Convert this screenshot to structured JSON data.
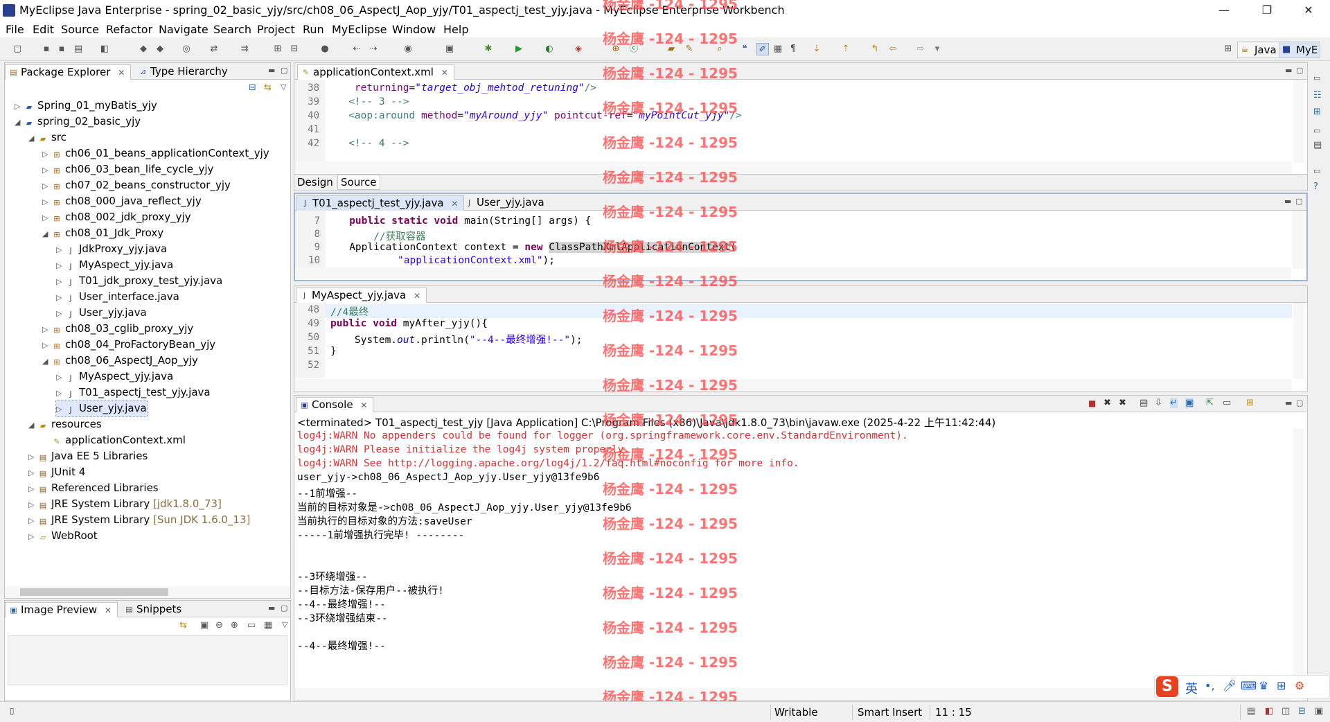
{
  "window": {
    "title": "MyEclipse Java Enterprise - spring_02_basic_yjy/src/ch08_06_AspectJ_Aop_yjy/T01_aspectj_test_yjy.java - MyEclipse Enterprise Workbench",
    "minimize": "—",
    "restore": "❐",
    "close": "✕"
  },
  "menu": [
    "File",
    "Edit",
    "Source",
    "Refactor",
    "Navigate",
    "Search",
    "Project",
    "Run",
    "MyEclipse",
    "Window",
    "Help"
  ],
  "perspectives": {
    "java": "Java",
    "myeclipse": "MyE"
  },
  "package_explorer": {
    "tabs": [
      "Package Explorer",
      "Type Hierarchy"
    ],
    "tree": [
      {
        "label": "Spring_01_myBatis_yjy",
        "indent": 0,
        "icon": "project-icon",
        "exp": "▷"
      },
      {
        "label": "spring_02_basic_yjy",
        "indent": 0,
        "icon": "project-icon",
        "exp": "◢"
      },
      {
        "label": "src",
        "indent": 1,
        "icon": "source-folder-icon",
        "exp": "◢"
      },
      {
        "label": "ch06_01_beans_applicationContext_yjy",
        "indent": 2,
        "icon": "package-icon",
        "exp": "▷"
      },
      {
        "label": "ch06_03_bean_life_cycle_yjy",
        "indent": 2,
        "icon": "package-icon",
        "exp": "▷"
      },
      {
        "label": "ch07_02_beans_constructor_yjy",
        "indent": 2,
        "icon": "package-icon",
        "exp": "▷"
      },
      {
        "label": "ch08_000_java_reflect_yjy",
        "indent": 2,
        "icon": "package-icon",
        "exp": "▷"
      },
      {
        "label": "ch08_002_jdk_proxy_yjy",
        "indent": 2,
        "icon": "package-icon",
        "exp": "▷"
      },
      {
        "label": "ch08_01_Jdk_Proxy",
        "indent": 2,
        "icon": "package-icon",
        "exp": "◢"
      },
      {
        "label": "JdkProxy_yjy.java",
        "indent": 3,
        "icon": "java-file-icon",
        "exp": "▷"
      },
      {
        "label": "MyAspect_yjy.java",
        "indent": 3,
        "icon": "java-file-icon",
        "exp": "▷"
      },
      {
        "label": "T01_jdk_proxy_test_yjy.java",
        "indent": 3,
        "icon": "java-file-icon",
        "exp": "▷"
      },
      {
        "label": "User_interface.java",
        "indent": 3,
        "icon": "java-file-icon",
        "exp": "▷"
      },
      {
        "label": "User_yjy.java",
        "indent": 3,
        "icon": "java-file-icon",
        "exp": "▷"
      },
      {
        "label": "ch08_03_cglib_proxy_yjy",
        "indent": 2,
        "icon": "package-icon",
        "exp": "▷"
      },
      {
        "label": "ch08_04_ProFactoryBean_yjy",
        "indent": 2,
        "icon": "package-icon",
        "exp": "▷"
      },
      {
        "label": "ch08_06_AspectJ_Aop_yjy",
        "indent": 2,
        "icon": "package-icon",
        "exp": "◢"
      },
      {
        "label": "MyAspect_yjy.java",
        "indent": 3,
        "icon": "java-file-icon",
        "exp": "▷"
      },
      {
        "label": "T01_aspectj_test_yjy.java",
        "indent": 3,
        "icon": "java-file-icon",
        "exp": "▷"
      },
      {
        "label": "User_yjy.java",
        "indent": 3,
        "icon": "java-file-icon",
        "exp": "▷",
        "selected": true
      },
      {
        "label": "resources",
        "indent": 1,
        "icon": "source-folder-icon",
        "exp": "◢"
      },
      {
        "label": "applicationContext.xml",
        "indent": 2,
        "icon": "xml-file-icon",
        "exp": ""
      },
      {
        "label": "Java EE 5 Libraries",
        "indent": 1,
        "icon": "library-icon",
        "exp": "▷"
      },
      {
        "label": "JUnit 4",
        "indent": 1,
        "icon": "library-icon",
        "exp": "▷"
      },
      {
        "label": "Referenced Libraries",
        "indent": 1,
        "icon": "library-icon",
        "exp": "▷"
      },
      {
        "label": "JRE System Library",
        "suffix": "[jdk1.8.0_73]",
        "indent": 1,
        "icon": "library-icon",
        "exp": "▷"
      },
      {
        "label": "JRE System Library",
        "suffix": "[Sun JDK 1.6.0_13]",
        "indent": 1,
        "icon": "library-icon",
        "exp": "▷"
      },
      {
        "label": "WebRoot",
        "indent": 1,
        "icon": "folder-icon",
        "exp": "▷"
      }
    ]
  },
  "image_preview": {
    "tabs": [
      "Image Preview",
      "Snippets"
    ]
  },
  "xml_editor": {
    "tab": "applicationContext.xml",
    "bottom_tabs": [
      "Design",
      "Source"
    ],
    "lines": [
      {
        "n": "38",
        "html": "    <span class=\"attr\">returning</span>=<span class=\"attrval\">\"target_obj_mehtod_retuning\"</span><span class=\"tag\">/&gt;</span>"
      },
      {
        "n": "39",
        "html": "   <span class=\"cm\">&lt;!-- 3 --&gt;</span>"
      },
      {
        "n": "40",
        "html": "   <span class=\"tag\">&lt;aop:around</span> <span class=\"attr\">method</span>=<span class=\"attrval\">\"myAround_yjy\"</span> <span class=\"attr\">pointcut-ref</span>=<span class=\"attrval\">\"myPointCut_yjy\"</span><span class=\"tag\">/&gt;</span>"
      },
      {
        "n": "41",
        "html": ""
      },
      {
        "n": "42",
        "html": "   <span class=\"cm\">&lt;!-- 4 --&gt;</span>"
      }
    ]
  },
  "java_editor": {
    "tabs": [
      "T01_aspectj_test_yjy.java",
      "User_yjy.java"
    ],
    "lines": [
      {
        "n": "7",
        "html": "   <span class=\"kw\">public static void</span> main(String[] args) {"
      },
      {
        "n": "8",
        "html": "       <span class=\"cm\">//获取容器</span>"
      },
      {
        "n": "9",
        "html": "   ApplicationContext context = <span class=\"kw\">new</span> <span style=\"background:#d4d4d4\">ClassPathXmlApplicationContext</span>("
      },
      {
        "n": "10",
        "html": "           <span class=\"str\">\"applicationContext.xml\"</span>);"
      }
    ]
  },
  "aspect_editor": {
    "tab": "MyAspect_yjy.java",
    "lines": [
      {
        "n": "48",
        "html": "<span class=\"cm\">//4最终</span>"
      },
      {
        "n": "49",
        "html": "<span class=\"kw\">public void</span> myAfter_yjy(){"
      },
      {
        "n": "50",
        "html": "    System.<span style=\"color:#0000c0;font-style:italic\">out</span>.println(<span class=\"str\">\"--4--最终增强!--\"</span>);"
      },
      {
        "n": "51",
        "html": "}"
      },
      {
        "n": "52",
        "html": ""
      }
    ]
  },
  "console": {
    "tab": "Console",
    "header": "<terminated> T01_aspectj_test_yjy [Java Application] C:\\Program Files (x86)\\Java\\jdk1.8.0_73\\bin\\javaw.exe (2025-4-22 上午11:42:44)",
    "lines": [
      {
        "text": "log4j:WARN No appenders could be found for logger (org.springframework.core.env.StandardEnvironment).",
        "red": true
      },
      {
        "text": "log4j:WARN Please initialize the log4j system properly.",
        "red": true
      },
      {
        "text": "log4j:WARN See http://logging.apache.org/log4j/1.2/faq.html#noconfig for more info.",
        "red": true
      },
      {
        "text": "user_yjy->ch08_06_AspectJ_Aop_yjy.User_yjy@13fe9b6",
        "red": false
      },
      {
        "text": "--1前增强--",
        "red": false
      },
      {
        "text": "当前的目标对象是->ch08_06_AspectJ_Aop_yjy.User_yjy@13fe9b6",
        "red": false
      },
      {
        "text": "当前执行的目标对象的方法:saveUser",
        "red": false
      },
      {
        "text": "-----1前增强执行完毕! --------",
        "red": false
      },
      {
        "text": "",
        "red": false
      },
      {
        "text": "",
        "red": false
      },
      {
        "text": "--3环绕增强--",
        "red": false
      },
      {
        "text": "--目标方法-保存用户--被执行!",
        "red": false
      },
      {
        "text": "--4--最终增强!--",
        "red": false
      },
      {
        "text": "--3环绕增强结束--",
        "red": false
      },
      {
        "text": "",
        "red": false
      },
      {
        "text": "--4--最终增强!--",
        "red": false
      }
    ]
  },
  "watermark": "杨金鹰 -124 - 1295",
  "ime": {
    "label": "英",
    "brand": "S"
  },
  "statusbar": {
    "writable": "Writable",
    "insert": "Smart Insert",
    "position": "11 : 15"
  }
}
